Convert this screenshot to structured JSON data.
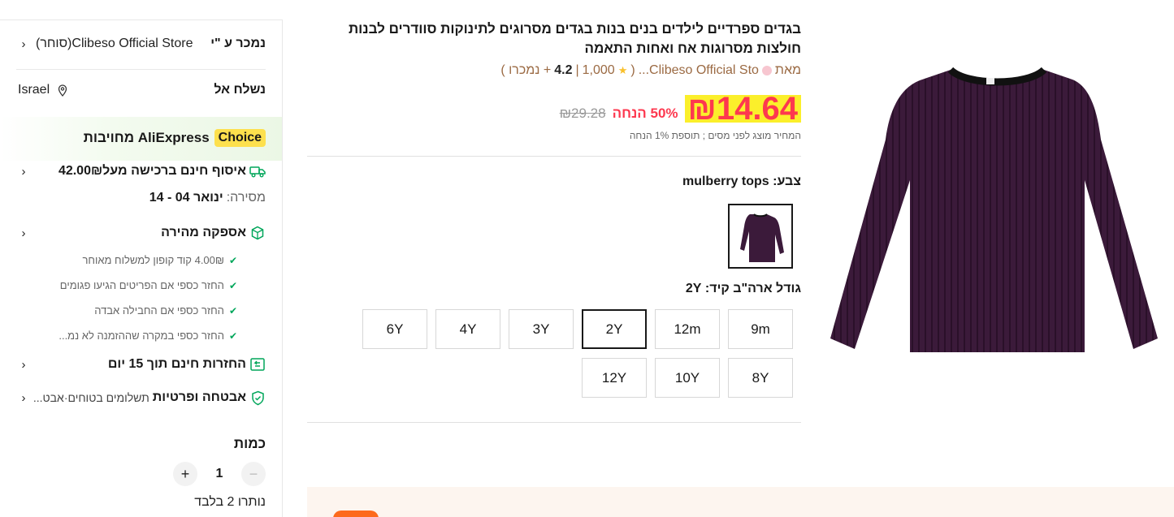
{
  "sidebar": {
    "seller_label": "נמכר ע \"י",
    "seller_store": "Clibeso Official Store(סוחר)",
    "ship_to_label": "נשלח אל",
    "ship_to_country": "Israel",
    "choice_badge": "Choice",
    "choice_text": "AliExpress מחויבות",
    "pickup_text": "איסוף חינם ברכישה מעל42.00₪",
    "delivery_label": "מסירה:",
    "delivery_value": "ינואר 04 - 14",
    "fast_delivery": "אספקה מהירה",
    "guarantees": [
      "4.00₪ קוד קופון למשלוח מאוחר",
      "החזר כספי אם הפריטים הגיעו פגומים",
      "החזר כספי אם החבילה אבדה",
      "החזר כספי במקרה שההזמנה לא נמ..."
    ],
    "returns": "החזרות חינם תוך 15 יום",
    "security_title": "אבטחה ופרטיות",
    "security_sub": "תשלומים בטוחים·אבט...",
    "quantity_title": "כמות",
    "quantity_value": "1",
    "minus_symbol": "−",
    "plus_symbol": "+",
    "stock_left": "נותרו 2 בלבד",
    "chevron": "‹"
  },
  "product": {
    "title": "בגדים ספרדיים לילדים בנים בנות בגדים מסרוגים לתינוקות סוודרים לבנות חולצות מסרוגות אח ואחות התאמה",
    "store_prefix": "מאת",
    "store_name": "Clibeso Official Sto...",
    "rating": "4.2",
    "reviews": "1,000",
    "sold": "+ נמכרו )",
    "price_now": "₪14.64",
    "discount": "50% הנחה",
    "price_old": "₪29.28",
    "tax_note": "המחיר מוצג לפני מסים ; תוספת 1% הנחה",
    "color_label": "צבע: mulberry tops",
    "size_label": "גודל ארה\"ב קיד: 2Y",
    "sizes": [
      "9m",
      "12m",
      "2Y",
      "3Y",
      "4Y",
      "6Y",
      "8Y",
      "10Y",
      "12Y"
    ],
    "selected_size": "2Y"
  },
  "colors": {
    "price_red": "#fd384f",
    "highlight": "#fbef2b",
    "sweater": "#3b1a3a",
    "choice_yellow": "#fde04d",
    "green_check": "#00a65a"
  }
}
